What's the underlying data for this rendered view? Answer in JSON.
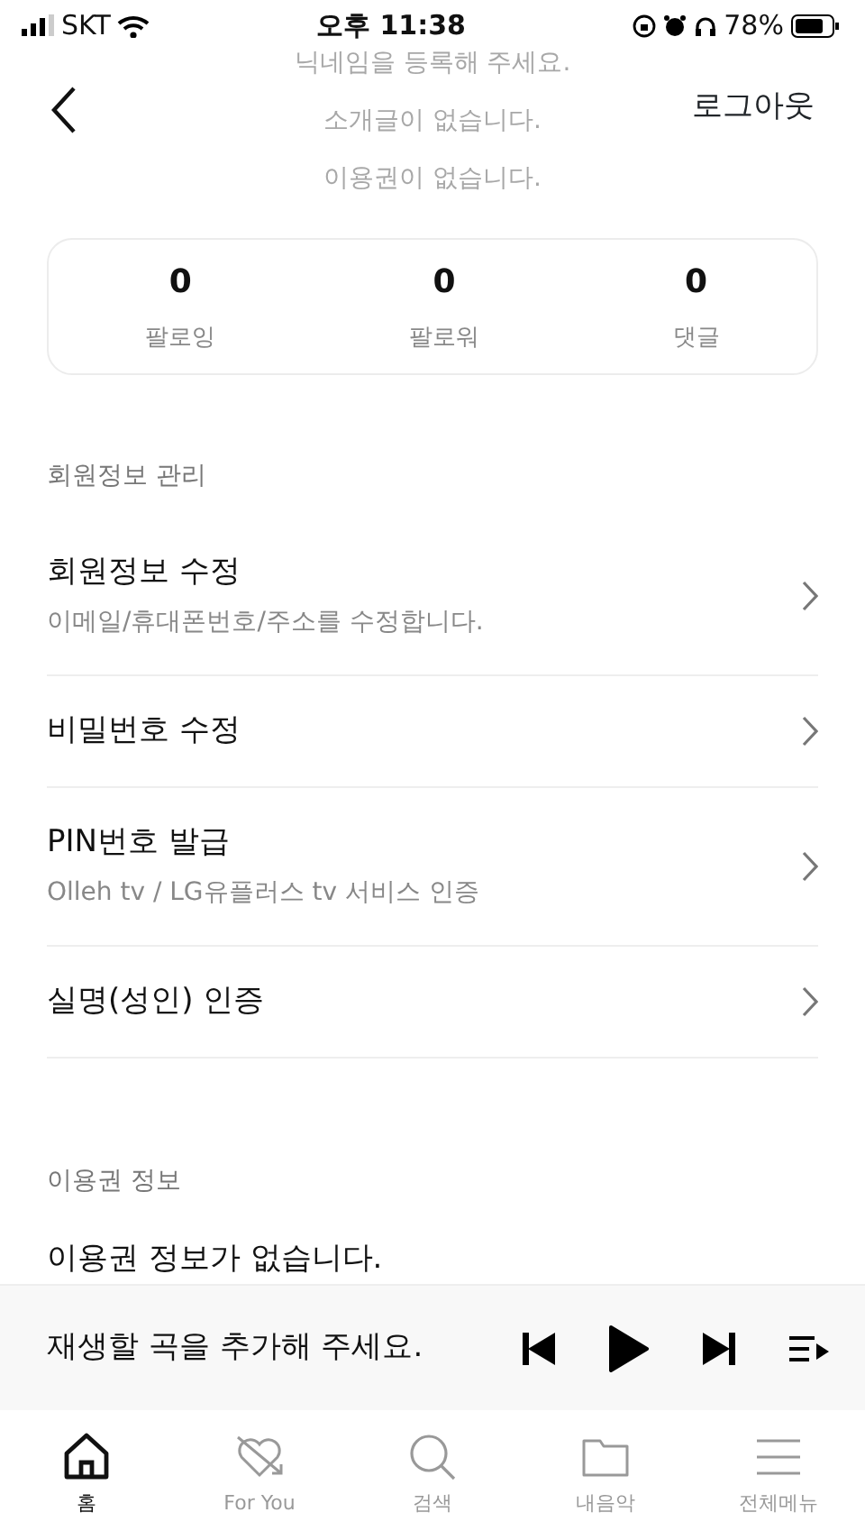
{
  "status_bar": {
    "carrier": "SKT",
    "time": "오후 11:38",
    "battery": "78%"
  },
  "header": {
    "faded_texts": [
      "닉네임을 등록해 주세요.",
      "소개글이 없습니다.",
      "이용권이 없습니다."
    ],
    "action": "로그아웃"
  },
  "stats": [
    {
      "value": "0",
      "label": "팔로잉"
    },
    {
      "value": "0",
      "label": "팔로워"
    },
    {
      "value": "0",
      "label": "댓글"
    }
  ],
  "sections": [
    {
      "title": "회원정보 관리",
      "items": [
        {
          "title": "회원정보 수정",
          "subtitle": "이메일/휴대폰번호/주소를 수정합니다."
        },
        {
          "title": "비밀번호 수정"
        },
        {
          "title": "PIN번호 발급",
          "subtitle": "Olleh tv / LG유플러스 tv 서비스 인증"
        },
        {
          "title": "실명(성인) 인증"
        }
      ]
    },
    {
      "title": "이용권 정보",
      "note": "이용권 정보가 없습니다."
    }
  ],
  "player": {
    "message": "재생할 곡을 추가해 주세요."
  },
  "tabs": [
    {
      "label": "홈",
      "selected": true
    },
    {
      "label": "For You",
      "selected": false
    },
    {
      "label": "검색",
      "selected": false
    },
    {
      "label": "내음악",
      "selected": false
    },
    {
      "label": "전체메뉴",
      "selected": false
    }
  ]
}
